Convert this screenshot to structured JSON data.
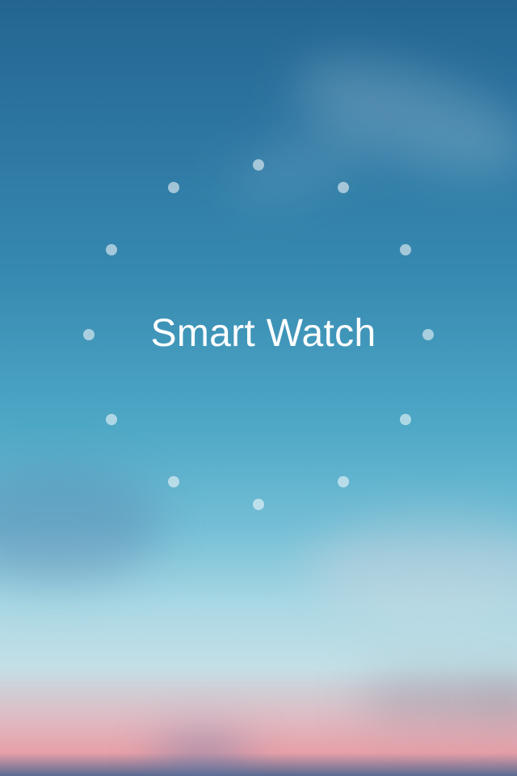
{
  "splash": {
    "app_title": "Smart Watch",
    "background": {
      "sky_top": "#236590",
      "sky_middle": "#4ea8c6",
      "horizon_pink": "#e7a0a8"
    },
    "dial": {
      "marker_count": 12,
      "marker_color": "rgba(255,255,255,0.55)"
    }
  }
}
